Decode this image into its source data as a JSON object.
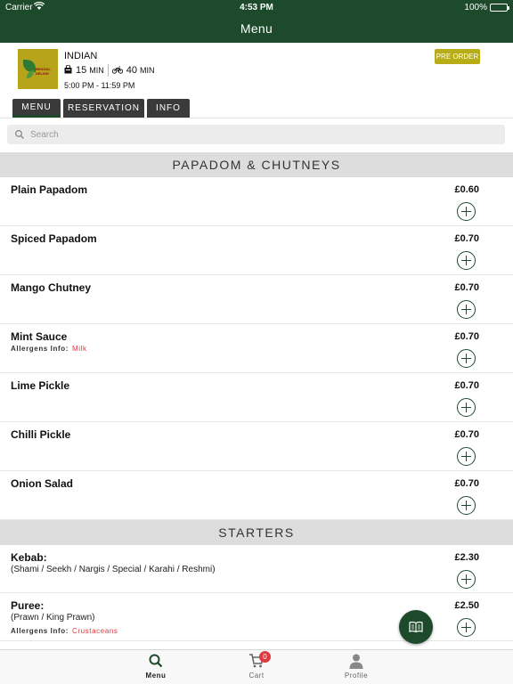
{
  "status_bar": {
    "carrier": "Carrier",
    "time": "4:53 PM",
    "battery": "100%"
  },
  "header": {
    "title": "Menu"
  },
  "restaurant": {
    "logo_text": "BENGAL DELISH",
    "cuisine": "INDIAN",
    "collection_time": "15",
    "collection_unit": "MIN",
    "delivery_time": "40",
    "delivery_unit": "MIN",
    "hours": "5:00 PM - 11:59 PM",
    "pre_order_label": "PRE ORDER"
  },
  "tabs": [
    {
      "label": "MENU",
      "active": true
    },
    {
      "label": "RESERVATION",
      "active": false
    },
    {
      "label": "INFO",
      "active": false
    }
  ],
  "search": {
    "placeholder": "Search",
    "value": ""
  },
  "sections": [
    {
      "title": "PAPADOM & CHUTNEYS",
      "items": [
        {
          "name": "Plain Papadom",
          "price": "£0.60"
        },
        {
          "name": "Spiced Papadom",
          "price": "£0.70"
        },
        {
          "name": "Mango Chutney",
          "price": "£0.70"
        },
        {
          "name": "Mint Sauce",
          "price": "£0.70",
          "allergens_label": "Allergens Info:",
          "allergens": "Milk"
        },
        {
          "name": "Lime Pickle",
          "price": "£0.70"
        },
        {
          "name": "Chilli Pickle",
          "price": "£0.70"
        },
        {
          "name": "Onion Salad",
          "price": "£0.70"
        }
      ]
    },
    {
      "title": "STARTERS",
      "items": [
        {
          "name": "Kebab:",
          "desc": "(Shami / Seekh / Nargis / Special / Karahi / Reshmi)",
          "price": "£2.30"
        },
        {
          "name": "Puree:",
          "desc": "(Prawn / King Prawn)",
          "price": "£2.50",
          "allergens_label": "Allergens Info:",
          "allergens": "Crustaceans"
        }
      ]
    }
  ],
  "bottom_nav": [
    {
      "label": "Menu",
      "icon": "search-icon",
      "active": true
    },
    {
      "label": "Cart",
      "icon": "cart-icon",
      "badge": "0",
      "active": false
    },
    {
      "label": "Profile",
      "icon": "profile-icon",
      "active": false
    }
  ],
  "colors": {
    "brand": "#1d4a2b",
    "accent": "#b7ad18",
    "allergen": "#e0393e"
  }
}
